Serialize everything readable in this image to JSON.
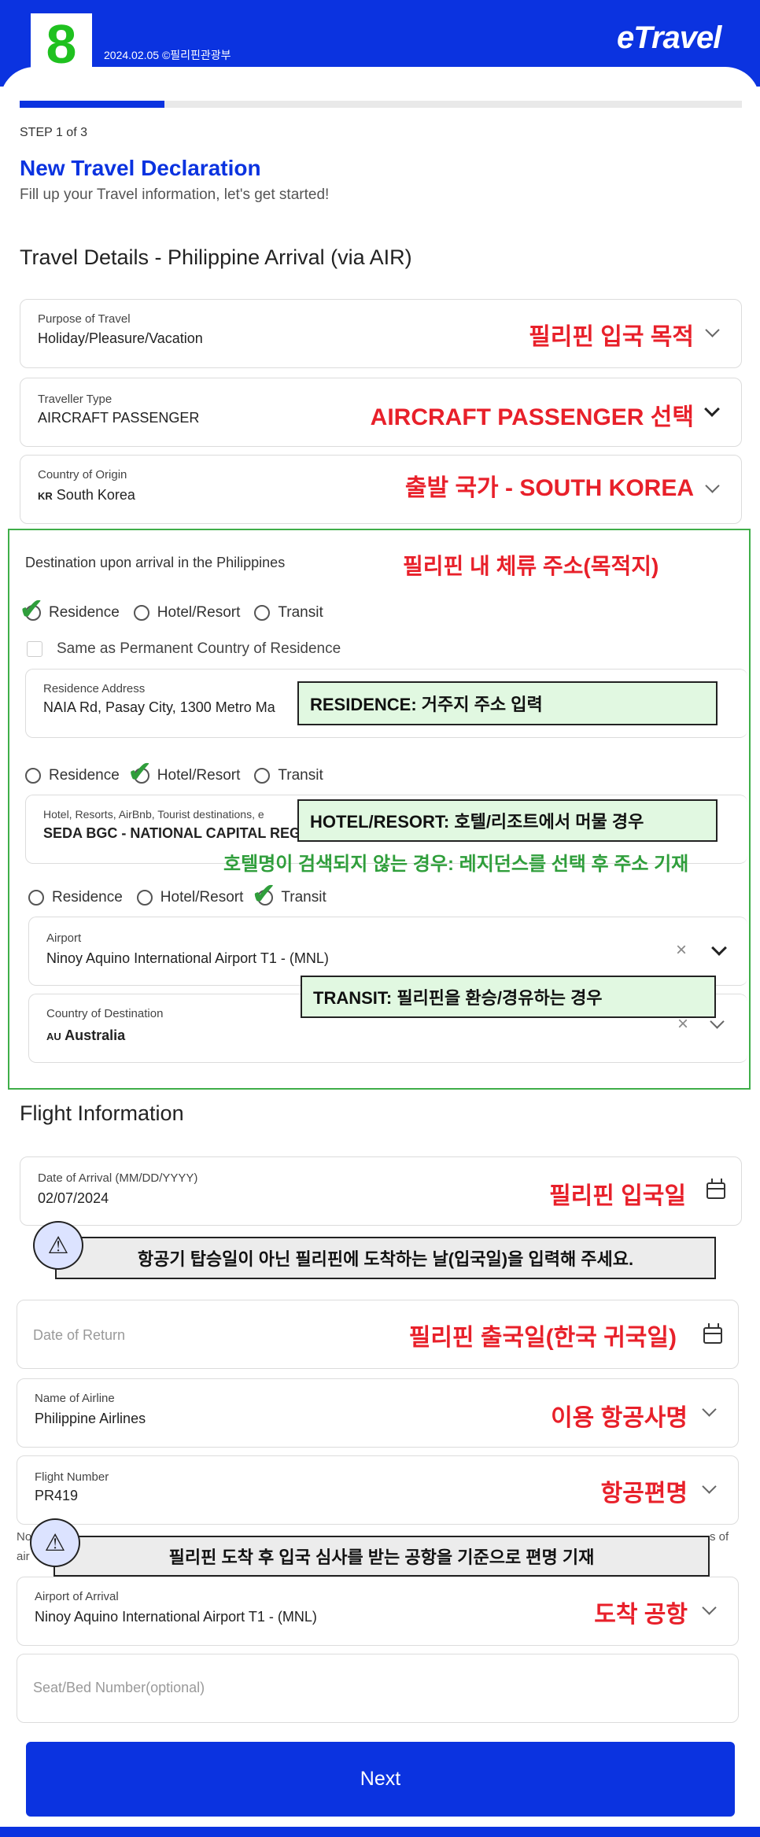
{
  "header": {
    "badge_number": "8",
    "date_credit": "2024.02.05 ©필리핀관광부",
    "logo": "eTravel"
  },
  "progress": {
    "fraction": 0.2,
    "step_label": "STEP 1 of 3"
  },
  "page": {
    "title": "New Travel Declaration",
    "subtitle": "Fill up your Travel information, let's get started!"
  },
  "travel_details": {
    "section_title": "Travel Details - Philippine Arrival (via AIR)",
    "purpose": {
      "label": "Purpose of Travel",
      "value": "Holiday/Pleasure/Vacation",
      "note": "필리핀 입국 목적"
    },
    "traveller_type": {
      "label": "Traveller Type",
      "value": "AIRCRAFT PASSENGER",
      "note": "AIRCRAFT PASSENGER 선택"
    },
    "origin": {
      "label": "Country of Origin",
      "flag_code": "KR",
      "value": "South Korea",
      "note": "출발 국가 - SOUTH KOREA"
    }
  },
  "destination": {
    "label": "Destination upon arrival in the Philippines",
    "note": "필리핀 내 체류 주소(목적지)",
    "options": [
      "Residence",
      "Hotel/Resort",
      "Transit"
    ],
    "same_as_permanent": "Same as Permanent Country of Residence",
    "residence_address": {
      "label": "Residence Address",
      "value": "NAIA Rd, Pasay City, 1300 Metro Ma",
      "note": "RESIDENCE: 거주지 주소 입력"
    },
    "hotel": {
      "label": "Hotel, Resorts, AirBnb, Tourist destinations, e",
      "value": "SEDA BGC - NATIONAL CAPITAL REGI",
      "note": "HOTEL/RESORT: 호텔/리조트에서 머물 경우",
      "tip": "호텔명이 검색되지 않는 경우: 레지던스를 선택 후 주소 기재"
    },
    "transit_airport": {
      "label": "Airport",
      "value": "Ninoy Aquino International Airport T1 - (MNL)"
    },
    "transit_country": {
      "label": "Country of Destination",
      "flag_code": "AU",
      "value": "Australia",
      "note": "TRANSIT: 필리핀을 환승/경유하는 경우"
    }
  },
  "flight": {
    "section_title": "Flight Information",
    "arrival_date": {
      "label": "Date of Arrival (MM/DD/YYYY)",
      "value": "02/07/2024",
      "note": "필리핀 입국일"
    },
    "arrival_warning": "항공기 탑승일이 아닌 필리핀에 도착하는 날(입국일)을 입력해 주세요.",
    "return_date": {
      "placeholder": "Date of Return",
      "note": "필리핀 출국일(한국 귀국일)"
    },
    "airline": {
      "label": "Name of Airline",
      "value": "Philippine Airlines",
      "note": "이용 항공사명"
    },
    "flight_number": {
      "label": "Flight Number",
      "value": "PR419",
      "note": "항공편명"
    },
    "flight_warning": "필리핀 도착 후 입국 심사를 받는 공항을 기준으로 편명 기재",
    "cut_left": "No",
    "cut_left_2": "air",
    "cut_right": "s of",
    "arrival_airport": {
      "label": "Airport of Arrival",
      "value": "Ninoy Aquino International Airport T1 - (MNL)",
      "note": "도착 공항"
    },
    "seat": {
      "placeholder": "Seat/Bed Number(optional)"
    }
  },
  "next_button": "Next",
  "colors": {
    "brand_blue": "#0b33e0",
    "annotation_red": "#e8202a",
    "annotation_green": "#3fae49"
  }
}
